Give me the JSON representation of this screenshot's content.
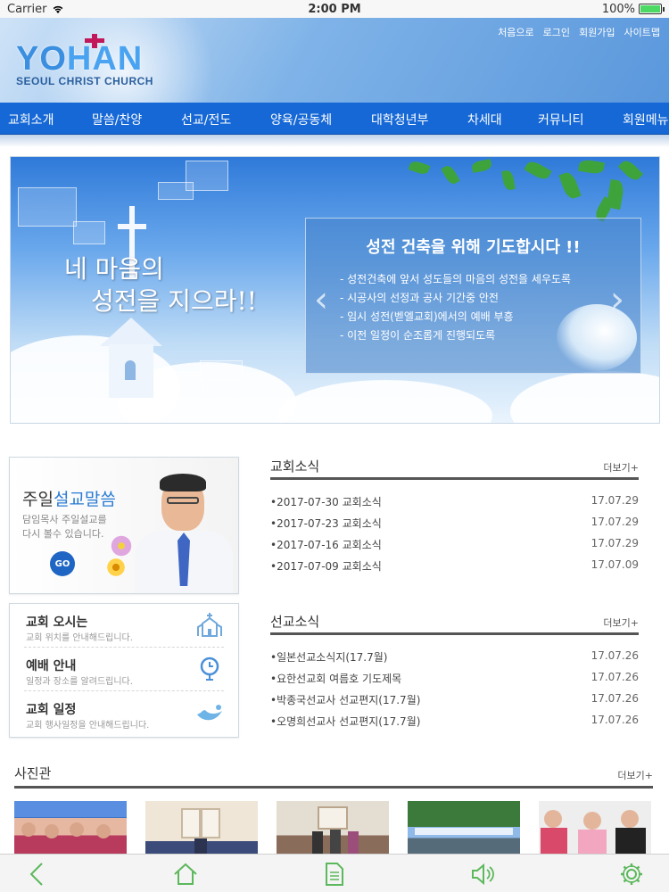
{
  "status": {
    "carrier": "Carrier",
    "time": "2:00 PM",
    "battery": "100%"
  },
  "header": {
    "logo_main_a": "YO",
    "logo_main_b": "HAN",
    "logo_sub": "SEOUL CHRIST CHURCH",
    "links": [
      "처음으로",
      "로그인",
      "회원가입",
      "사이트맵"
    ]
  },
  "nav": {
    "items": [
      "교회소개",
      "말씀/찬양",
      "선교/전도",
      "양육/공동체",
      "대학청년부",
      "차세대",
      "커뮤니티",
      "회원메뉴"
    ]
  },
  "banner": {
    "title_line1": "네 마음의",
    "title_line2": "성전을 지으라!!",
    "box_title": "성전 건축을 위해 기도합시다 !!",
    "box_items": [
      "- 성전건축에 앞서 성도들의 마음의 성전을 세우도록",
      "- 시공사의 선정과 공사 기간중 안전",
      "- 임시 성전(벧엘교회)에서의 예배 부흥",
      "- 이전 일정이 순조롭게 진행되도록"
    ]
  },
  "sermon": {
    "title_a": "주일",
    "title_b": "설교말씀",
    "desc_line1": "담임목사 주일설교를",
    "desc_line2": "다시 볼수 있습니다.",
    "go_label": "GO"
  },
  "info": {
    "items": [
      {
        "title": "교회 오시는",
        "sub": "교회 위치를 안내해드립니다."
      },
      {
        "title": "예배 안내",
        "sub": "일정과 장소를 알려드립니다."
      },
      {
        "title": "교회 일정",
        "sub": "교회 행사일정을 안내해드립니다."
      }
    ]
  },
  "church_news": {
    "title": "교회소식",
    "more": "더보기+",
    "rows": [
      {
        "text": "•2017-07-30 교회소식",
        "date": "17.07.29"
      },
      {
        "text": "•2017-07-23 교회소식",
        "date": "17.07.29"
      },
      {
        "text": "•2017-07-16 교회소식",
        "date": "17.07.29"
      },
      {
        "text": "•2017-07-09 교회소식",
        "date": "17.07.09"
      }
    ]
  },
  "mission_news": {
    "title": "선교소식",
    "more": "더보기+",
    "rows": [
      {
        "text": "•일본선교소식지(17.7월)",
        "date": "17.07.26"
      },
      {
        "text": "•요한선교회 여름호 기도제목",
        "date": "17.07.26"
      },
      {
        "text": "•박종국선교사 선교편지(17.7월)",
        "date": "17.07.26"
      },
      {
        "text": "•오명희선교사 선교편지(17.7월)",
        "date": "17.07.26"
      }
    ]
  },
  "gallery": {
    "title": "사진관",
    "more": "더보기+"
  },
  "colors": {
    "nav_bg": "#1668d6",
    "accent_blue": "#2a7bd4",
    "toolbar_icon": "#5cb85c"
  },
  "toolbar": {
    "icons": [
      "back-icon",
      "home-icon",
      "document-icon",
      "speaker-icon",
      "gear-icon"
    ]
  }
}
